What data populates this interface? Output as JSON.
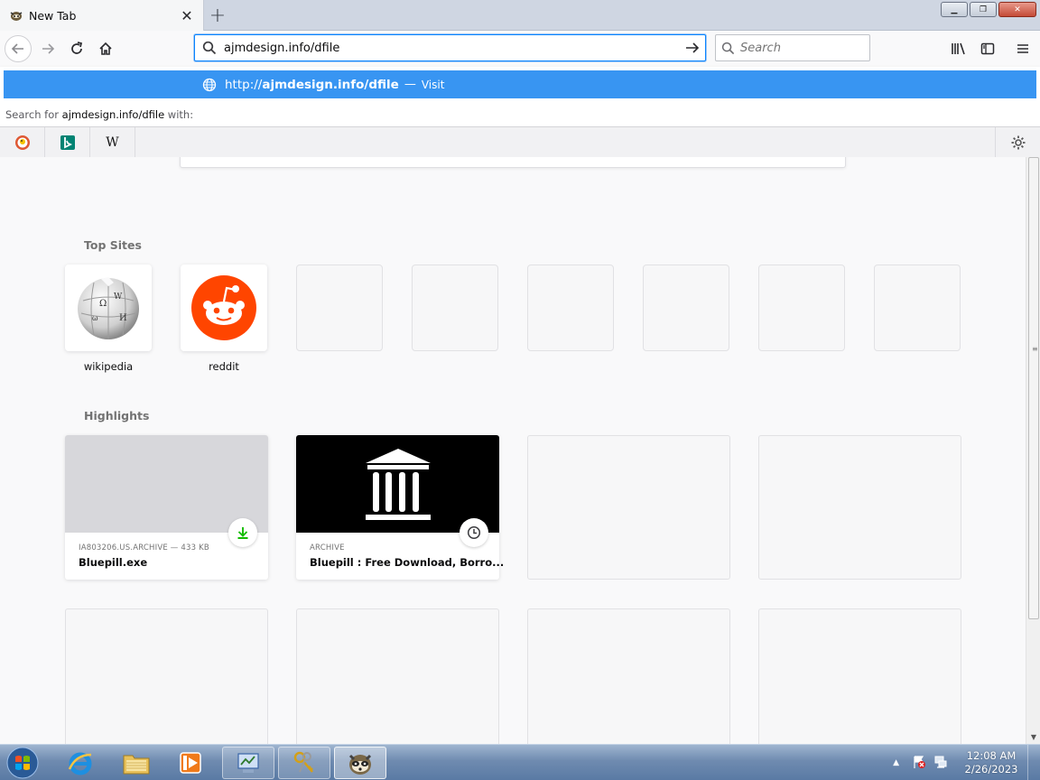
{
  "tab": {
    "title": "New Tab"
  },
  "urlbar": {
    "value": "ajmdesign.info/dfile"
  },
  "searchbar": {
    "placeholder": "Search"
  },
  "popup": {
    "suggestion_prefix": "http://",
    "suggestion_bold": "ajmdesign.info/dfile",
    "suggestion_dash": "—",
    "suggestion_action": "Visit",
    "search_for_prefix": "Search for ",
    "search_for_query": "ajmdesign.info/dfile",
    "search_for_suffix": " with:",
    "engines": [
      "duckduckgo-icon",
      "bing-icon",
      "wikipedia-icon"
    ]
  },
  "top_sites": {
    "heading": "Top Sites",
    "sites": [
      {
        "label": "wikipedia"
      },
      {
        "label": "reddit"
      }
    ]
  },
  "highlights": {
    "heading": "Highlights",
    "cards": [
      {
        "context": "IA803206.US.ARCHIVE — 433 KB",
        "title": "Bluepill.exe",
        "badge": "download-icon"
      },
      {
        "context": "ARCHIVE",
        "title": "Bluepill : Free Download, Borro...",
        "badge": "clock-icon"
      }
    ]
  },
  "taskbar": {
    "time": "12:08 AM",
    "date": "2/26/2023"
  },
  "colors": {
    "accent": "#0a84ff",
    "suggest_bg": "#3895f2",
    "reddit": "#ff4500",
    "download_green": "#12bc00"
  }
}
